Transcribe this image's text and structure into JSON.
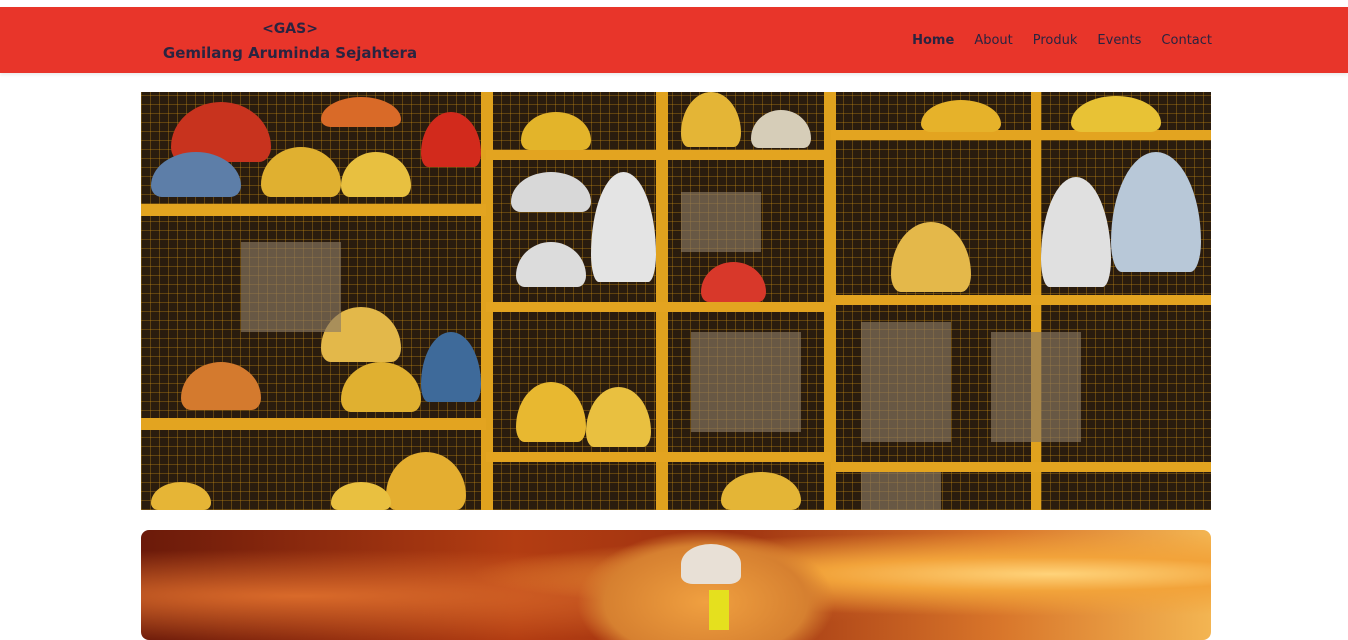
{
  "header": {
    "brand_tag": "<GAS>",
    "brand_name": "Gemilang Aruminda Sejahtera",
    "nav": [
      {
        "label": "Home",
        "active": true
      },
      {
        "label": "About",
        "active": false
      },
      {
        "label": "Produk",
        "active": false
      },
      {
        "label": "Events",
        "active": false
      },
      {
        "label": "Contact",
        "active": false
      }
    ]
  },
  "colors": {
    "navbar_bg": "#e8352a",
    "nav_text": "#2a2440",
    "page_bg": "#ffffff"
  },
  "images": [
    {
      "name": "hero-helmet-rack",
      "description": "helmets on yellow mesh shelving"
    },
    {
      "name": "firefighter-flames-banner",
      "description": "firefighter in front of flames"
    }
  ]
}
